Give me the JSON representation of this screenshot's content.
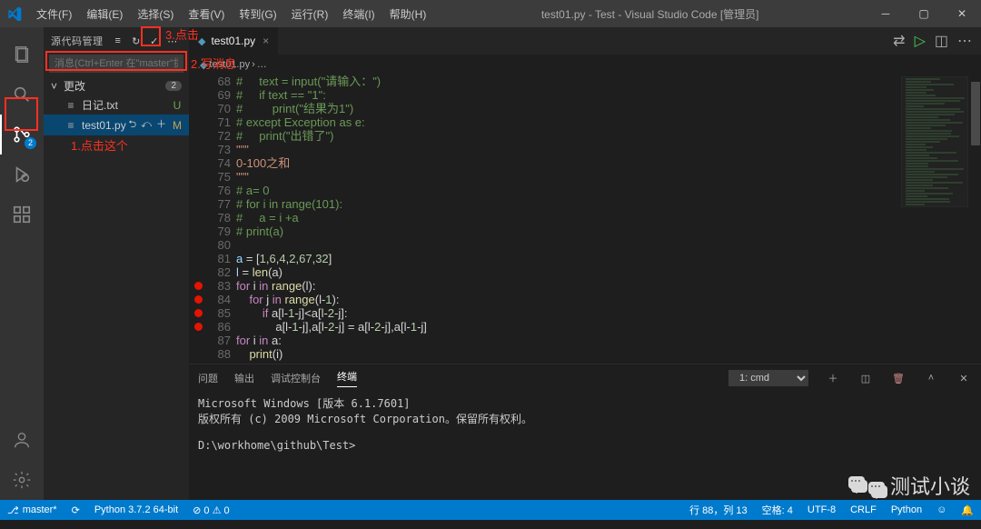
{
  "titlebar": {
    "menus": [
      "文件(F)",
      "编辑(E)",
      "选择(S)",
      "查看(V)",
      "转到(G)",
      "运行(R)",
      "终端(I)",
      "帮助(H)"
    ],
    "title": "test01.py - Test - Visual Studio Code [管理员]"
  },
  "activity": {
    "scm_badge": "2"
  },
  "scm": {
    "header": "源代码管理",
    "msg_placeholder": "消息(Ctrl+Enter 在\"master\"提…",
    "section": "更改",
    "section_count": "2",
    "files": [
      {
        "name": "日记.txt",
        "status": "U",
        "selected": false
      },
      {
        "name": "test01.py",
        "status": "M",
        "selected": true
      }
    ]
  },
  "tabs": {
    "file": "test01.py"
  },
  "crumb": {
    "file": "test01.py",
    "sep": "›",
    "more": "…"
  },
  "code": {
    "lines": [
      {
        "n": 68,
        "c": "cm",
        "t": "#     text = input(\"请输入：\")"
      },
      {
        "n": 69,
        "c": "cm",
        "t": "#     if text == \"1\":"
      },
      {
        "n": 70,
        "c": "cm",
        "t": "#         print(\"结果为1\")"
      },
      {
        "n": 71,
        "c": "cm",
        "t": "# except Exception as e:"
      },
      {
        "n": 72,
        "c": "cm",
        "t": "#     print(\"出错了\")"
      },
      {
        "n": 73,
        "c": "str",
        "t": "\"\"\""
      },
      {
        "n": 74,
        "c": "str",
        "t": "0-100之和"
      },
      {
        "n": 75,
        "c": "str",
        "t": "\"\"\""
      },
      {
        "n": 76,
        "c": "cm",
        "t": "# a= 0"
      },
      {
        "n": 77,
        "c": "cm",
        "t": "# for i in range(101):"
      },
      {
        "n": 78,
        "c": "cm",
        "t": "#     a = i +a"
      },
      {
        "n": 79,
        "c": "cm",
        "t": "# print(a)"
      },
      {
        "n": 80,
        "c": "",
        "t": ""
      },
      {
        "n": 81,
        "c": "",
        "t": "<span class=id>a</span> = [<span class=num>1</span>,<span class=num>6</span>,<span class=num>4</span>,<span class=num>2</span>,<span class=num>67</span>,<span class=num>32</span>]"
      },
      {
        "n": 82,
        "c": "",
        "t": "<span class=id>l</span> = <span class=fn>len</span>(a)"
      },
      {
        "n": 83,
        "bp": true,
        "c": "",
        "t": "<span class=kw>for</span> i <span class=kw>in</span> <span class=fn>range</span>(l):"
      },
      {
        "n": 84,
        "bp": true,
        "c": "",
        "t": "    <span class=kw>for</span> j <span class=kw>in</span> <span class=fn>range</span>(l-<span class=num>1</span>):"
      },
      {
        "n": 85,
        "bp": true,
        "c": "",
        "t": "        <span class=kw>if</span> a[l-<span class=num>1</span>-j]&lt;a[l-<span class=num>2</span>-j]:"
      },
      {
        "n": 86,
        "bp": true,
        "c": "",
        "t": "            a[l-<span class=num>1</span>-j],a[l-<span class=num>2</span>-j] = a[l-<span class=num>2</span>-j],a[l-<span class=num>1</span>-j]"
      },
      {
        "n": 87,
        "c": "",
        "t": "<span class=kw>for</span> i <span class=kw>in</span> a:"
      },
      {
        "n": 88,
        "c": "",
        "t": "    <span class=fn>print</span>(i)"
      }
    ]
  },
  "panel": {
    "tabs": [
      "问题",
      "输出",
      "调试控制台",
      "终端"
    ],
    "active": 3,
    "select": "1: cmd",
    "term": "Microsoft Windows [版本 6.1.7601]\n版权所有 (c) 2009 Microsoft Corporation。保留所有权利。\n\nD:\\workhome\\github\\Test>"
  },
  "status": {
    "branch": "master*",
    "sync": "⟳",
    "python": "Python 3.7.2 64-bit",
    "problems": "⊘ 0 ⚠ 0",
    "pos": "行 88，列 13",
    "spaces": "空格: 4",
    "enc": "UTF-8",
    "eol": "CRLF",
    "lang": "Python",
    "smile": "☺",
    "bell": "🔔"
  },
  "annot": {
    "a1": "1.点击这个",
    "a2": "2.写消息",
    "a3": "3.点击"
  },
  "watermark": "测试小谈"
}
